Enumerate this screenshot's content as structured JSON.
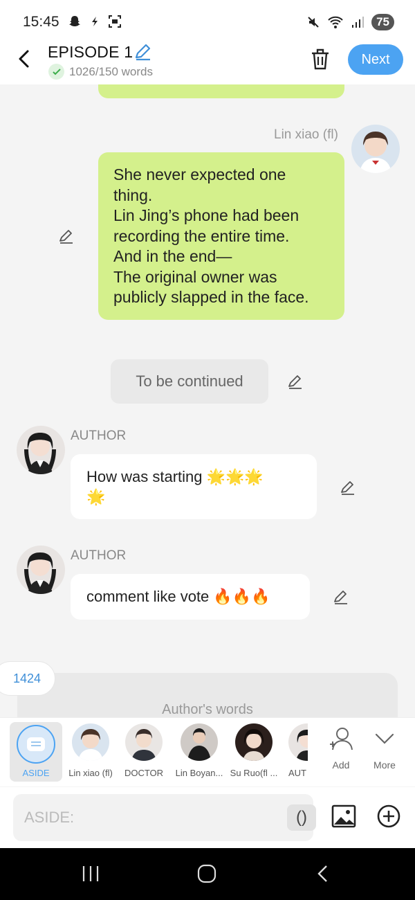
{
  "status_bar": {
    "time": "15:45",
    "battery": "75"
  },
  "header": {
    "title": "EPISODE 1",
    "word_count": "1026/150 words",
    "next_label": "Next"
  },
  "chat": {
    "messages": [
      {
        "speaker": "Lin xiao (fl)",
        "lines": [
          "She never expected one",
          "thing.",
          "Lin Jing’s phone had been",
          "recording the entire time.",
          "And in the end—",
          "The original owner was",
          "publicly slapped in the face."
        ]
      },
      {
        "speaker": "",
        "text": "To be continued"
      },
      {
        "speaker": "AUTHOR",
        "text_line1": "How was starting 🌟🌟🌟",
        "text_line2": "🌟"
      },
      {
        "speaker": "AUTHOR",
        "text": "comment like vote 🔥🔥🔥"
      }
    ],
    "count_badge": "1424",
    "authors_words": "Author's words"
  },
  "characters": [
    {
      "label": "ASIDE",
      "selected": true
    },
    {
      "label": "Lin xiao (fl)"
    },
    {
      "label": "DOCTOR"
    },
    {
      "label": "Lin Boyan..."
    },
    {
      "label": "Su Ruo(fl ..."
    },
    {
      "label": "AUT"
    }
  ],
  "strip_actions": {
    "add": "Add",
    "more": "More"
  },
  "input": {
    "placeholder": "ASIDE:",
    "paren_label": "()"
  },
  "colors": {
    "accent": "#4ca3f2",
    "green_bubble": "#d4f08c",
    "background": "#f4f4f4"
  },
  "icons": [
    "back-icon",
    "pencil-icon",
    "check-icon",
    "trash-icon",
    "edit-icon",
    "add-user-icon",
    "chevron-down-icon",
    "image-icon",
    "plus-circle-icon"
  ]
}
